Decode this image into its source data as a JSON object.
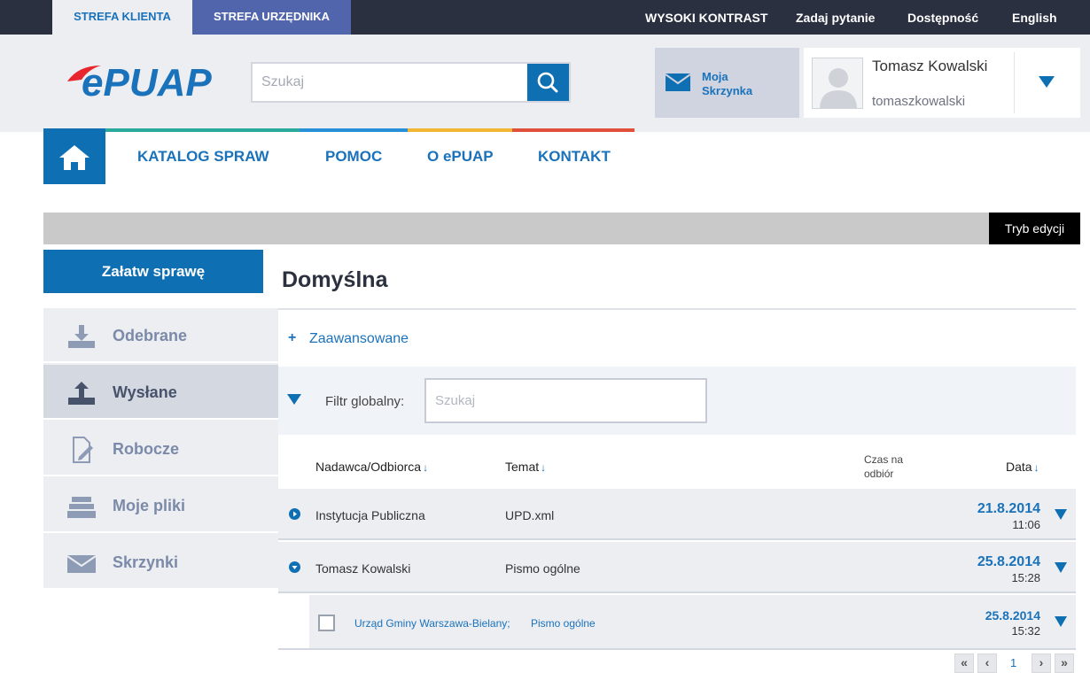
{
  "topbar": {
    "tab_client": "STREFA KLIENTA",
    "tab_official": "STREFA URZĘDNIKA",
    "high_contrast": "WYSOKI KONTRAST",
    "ask_question": "Zadaj pytanie",
    "accessibility": "Dostępność",
    "language": "English"
  },
  "header": {
    "logo_text": "ePUAP",
    "search_placeholder": "Szukaj",
    "inbox_label": "Moja Skrzynka",
    "user_name": "Tomasz Kowalski",
    "user_login": "tomaszkowalski"
  },
  "nav": {
    "items": [
      "KATALOG SPRAW",
      "POMOC",
      "O ePUAP",
      "KONTAKT"
    ],
    "stripe_colors": [
      "#2aa99c",
      "#2890d8",
      "#f2b632",
      "#e0503a"
    ]
  },
  "edit_mode": "Tryb edycji",
  "sidebar": {
    "settle_button": "Załatw sprawę",
    "items": [
      {
        "label": "Odebrane",
        "icon": "download-tray-icon",
        "active": false
      },
      {
        "label": "Wysłane",
        "icon": "upload-tray-icon",
        "active": true
      },
      {
        "label": "Robocze",
        "icon": "draft-document-icon",
        "active": false
      },
      {
        "label": "Moje pliki",
        "icon": "file-tray-icon",
        "active": false
      },
      {
        "label": "Skrzynki",
        "icon": "envelope-icon",
        "active": false
      }
    ]
  },
  "main": {
    "title": "Domyślna",
    "advanced_plus": "+",
    "advanced_link": "Zaawansowane",
    "filter_label": "Filtr globalny:",
    "filter_placeholder": "Szukaj",
    "columns": {
      "sender": "Nadawca/Odbiorca",
      "subject": "Temat",
      "pickup_time": "Czas na odbiór",
      "date": "Data"
    },
    "sort_arrow": "↓",
    "rows": [
      {
        "sender": "Instytucja Publiczna",
        "subject": "UPD.xml",
        "date": "21.8.2014",
        "time": "11:06"
      },
      {
        "sender": "Tomasz Kowalski",
        "subject": "Pismo ogólne",
        "date": "25.8.2014",
        "time": "15:28"
      }
    ],
    "sub_row": {
      "recipient": "Urząd Gminy Warszawa-Bielany;",
      "subject": "Pismo ogólne",
      "date": "25.8.2014",
      "time": "15:32"
    }
  },
  "pager": {
    "first": "«",
    "prev": "‹",
    "page": "1",
    "next": "›",
    "last": "»"
  }
}
